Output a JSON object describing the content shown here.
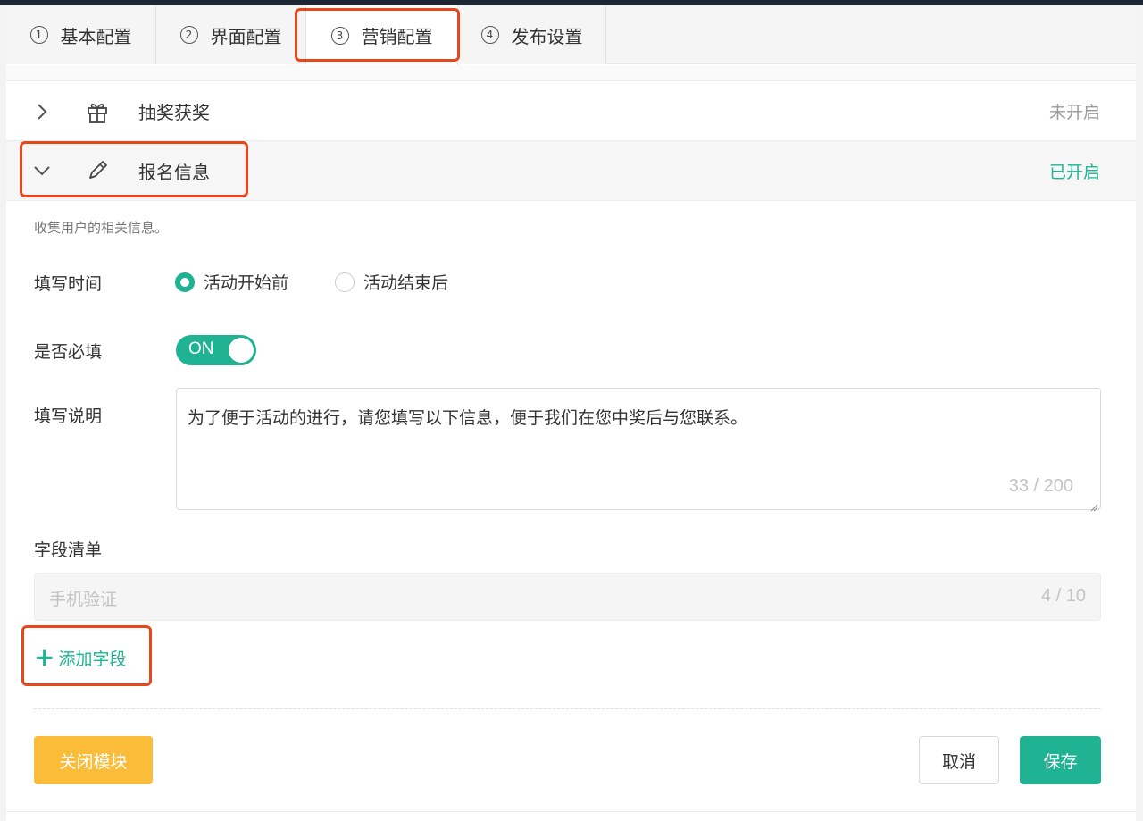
{
  "tabs": [
    {
      "num": "1",
      "label": "基本配置"
    },
    {
      "num": "2",
      "label": "界面配置"
    },
    {
      "num": "3",
      "label": "营销配置"
    },
    {
      "num": "4",
      "label": "发布设置"
    }
  ],
  "active_tab": "营销配置",
  "modules": [
    {
      "title": "抽奖获奖",
      "status": "未开启",
      "icon": "gift-icon",
      "expanded": false
    },
    {
      "title": "报名信息",
      "status": "已开启",
      "icon": "pencil-icon",
      "expanded": true
    }
  ],
  "signup": {
    "description": "收集用户的相关信息。",
    "fill_time_label": "填写时间",
    "fill_time_options": [
      "活动开始前",
      "活动结束后"
    ],
    "fill_time_selected": "活动开始前",
    "required_label": "是否必填",
    "required_toggle": "ON",
    "instructions_label": "填写说明",
    "instructions_value": "为了便于活动的进行，请您填写以下信息，便于我们在您中奖后与您联系。",
    "instructions_count": "33 / 200",
    "fields_label": "字段清单",
    "field_item": "手机验证",
    "field_count": "4 / 10",
    "add_field_label": "添加字段"
  },
  "actions": {
    "close_module": "关闭模块",
    "cancel": "取消",
    "save": "保存"
  },
  "colors": {
    "accent": "#1fb394",
    "warning_button": "#fbbd39",
    "highlight": "#e8471c"
  }
}
